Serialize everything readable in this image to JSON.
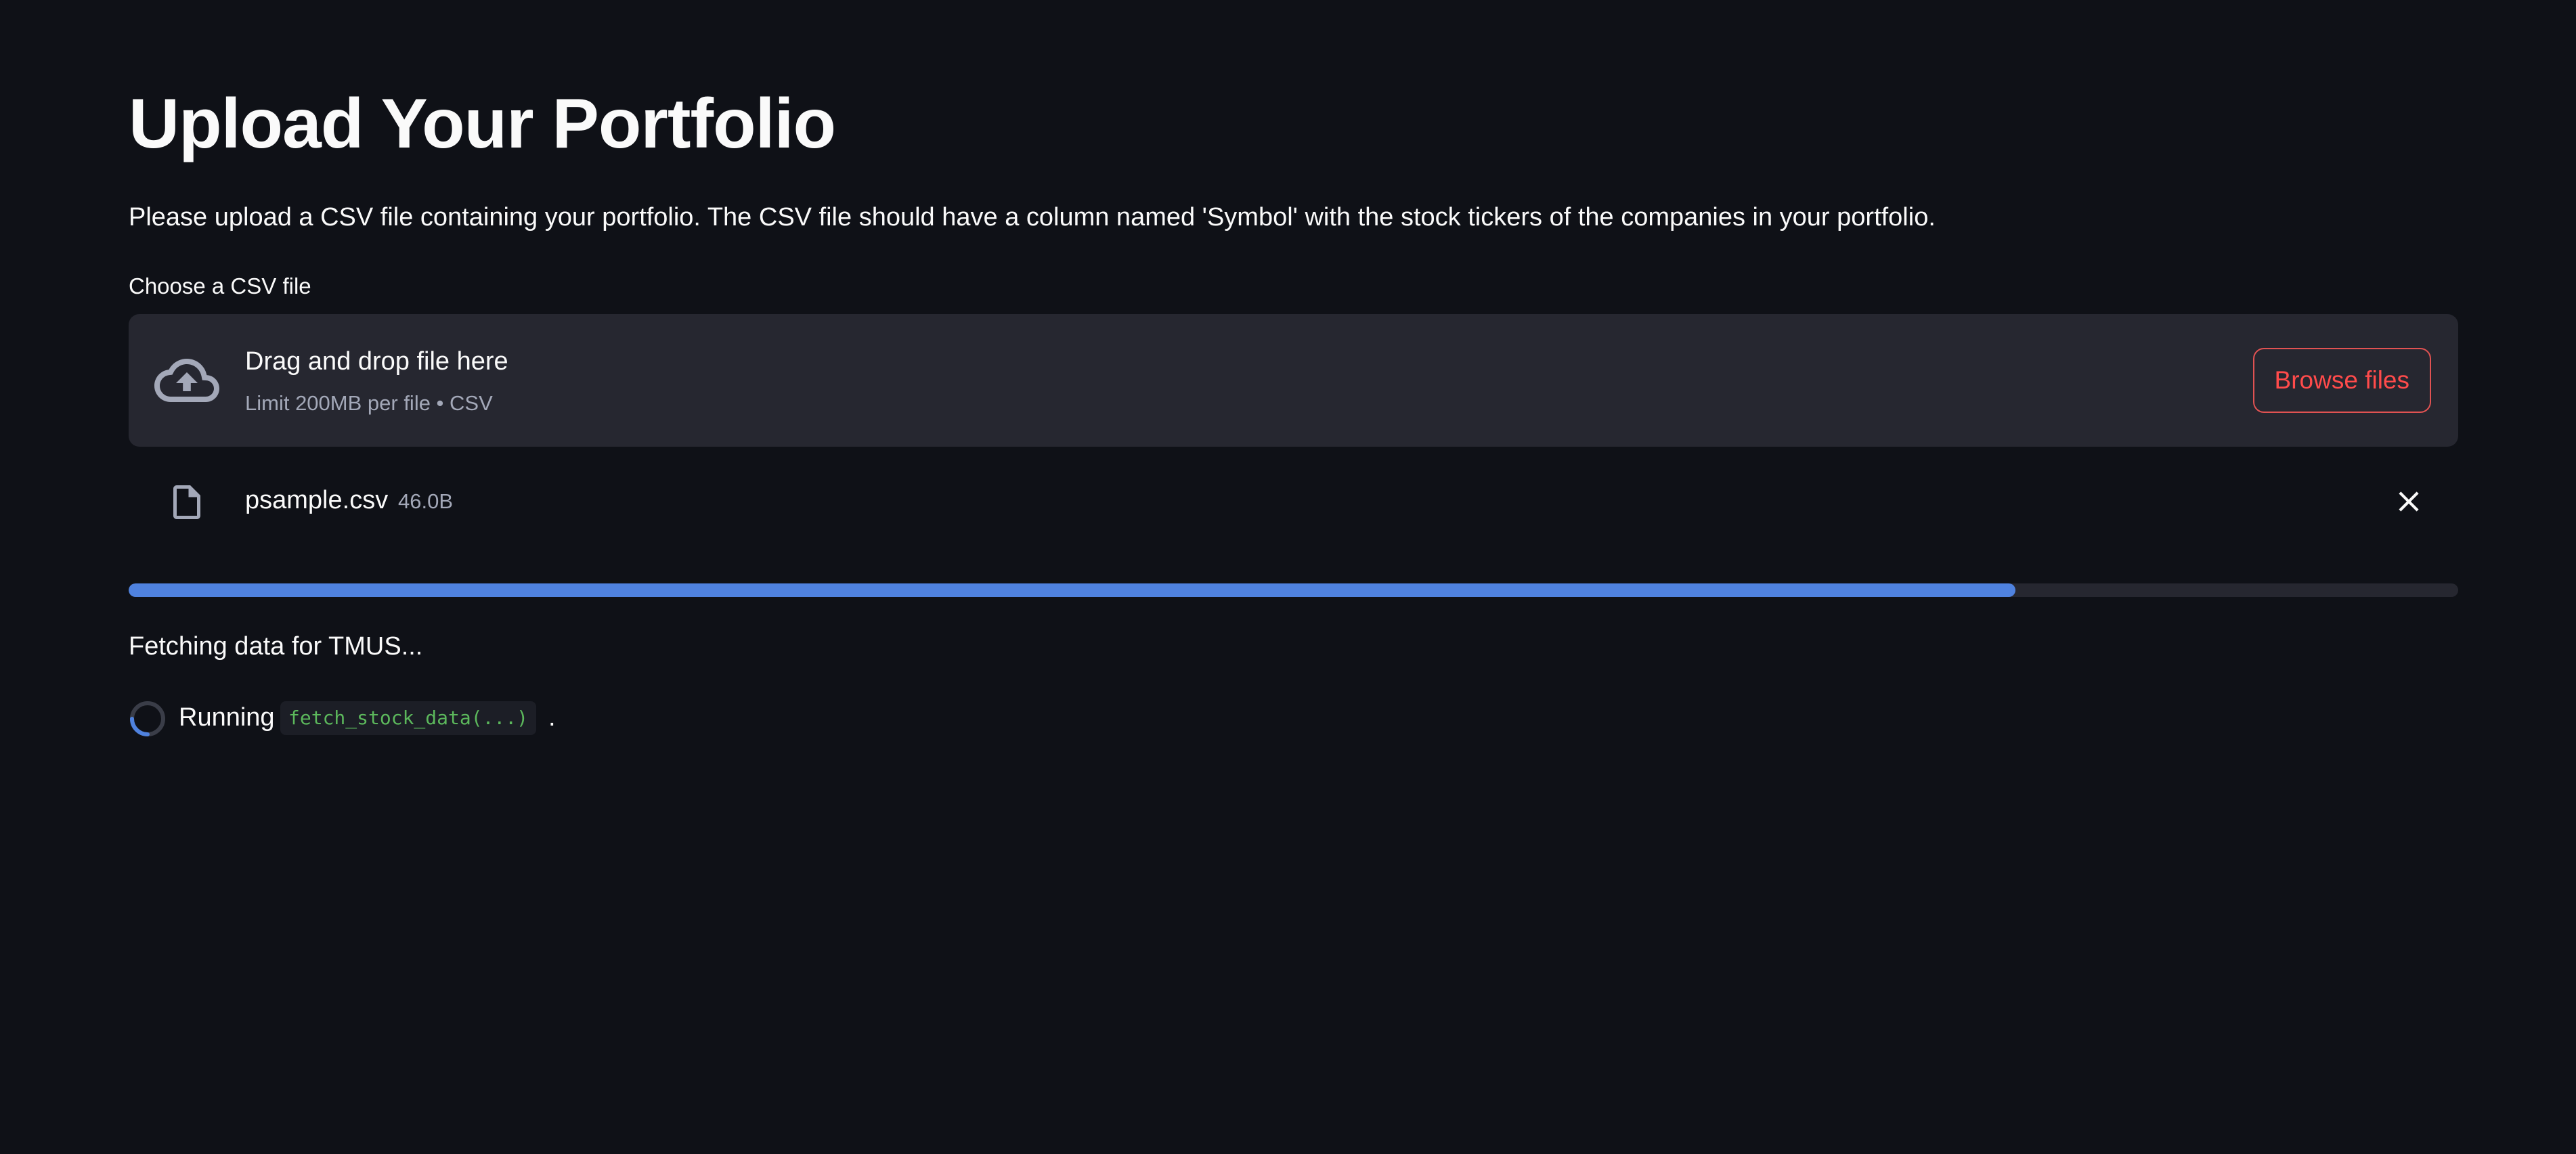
{
  "page": {
    "title": "Upload Your Portfolio",
    "intro": "Please upload a CSV file containing your portfolio. The CSV file should have a column named 'Symbol' with the stock tickers of the companies in your portfolio."
  },
  "uploader": {
    "label": "Choose a CSV file",
    "drop_text": "Drag and drop file here",
    "limit_text": "Limit 200MB per file • CSV",
    "browse_label": "Browse files",
    "icon": "cloud-upload-icon"
  },
  "uploaded_file": {
    "name": "psample.csv",
    "size": "46.0B",
    "icon": "file-icon",
    "remove_icon": "close-icon"
  },
  "progress": {
    "fraction": 0.81
  },
  "status": {
    "message": "Fetching data for TMUS...",
    "running_label": "Running",
    "running_code": "fetch_stock_data(...)",
    "running_suffix": "."
  },
  "colors": {
    "background": "#0f1117",
    "surface": "#262730",
    "text": "#fafafa",
    "muted_text": "#a3a8b8",
    "accent_red": "#ff4b4b",
    "progress_blue": "#4f82df",
    "code_green": "#5cb85c"
  }
}
